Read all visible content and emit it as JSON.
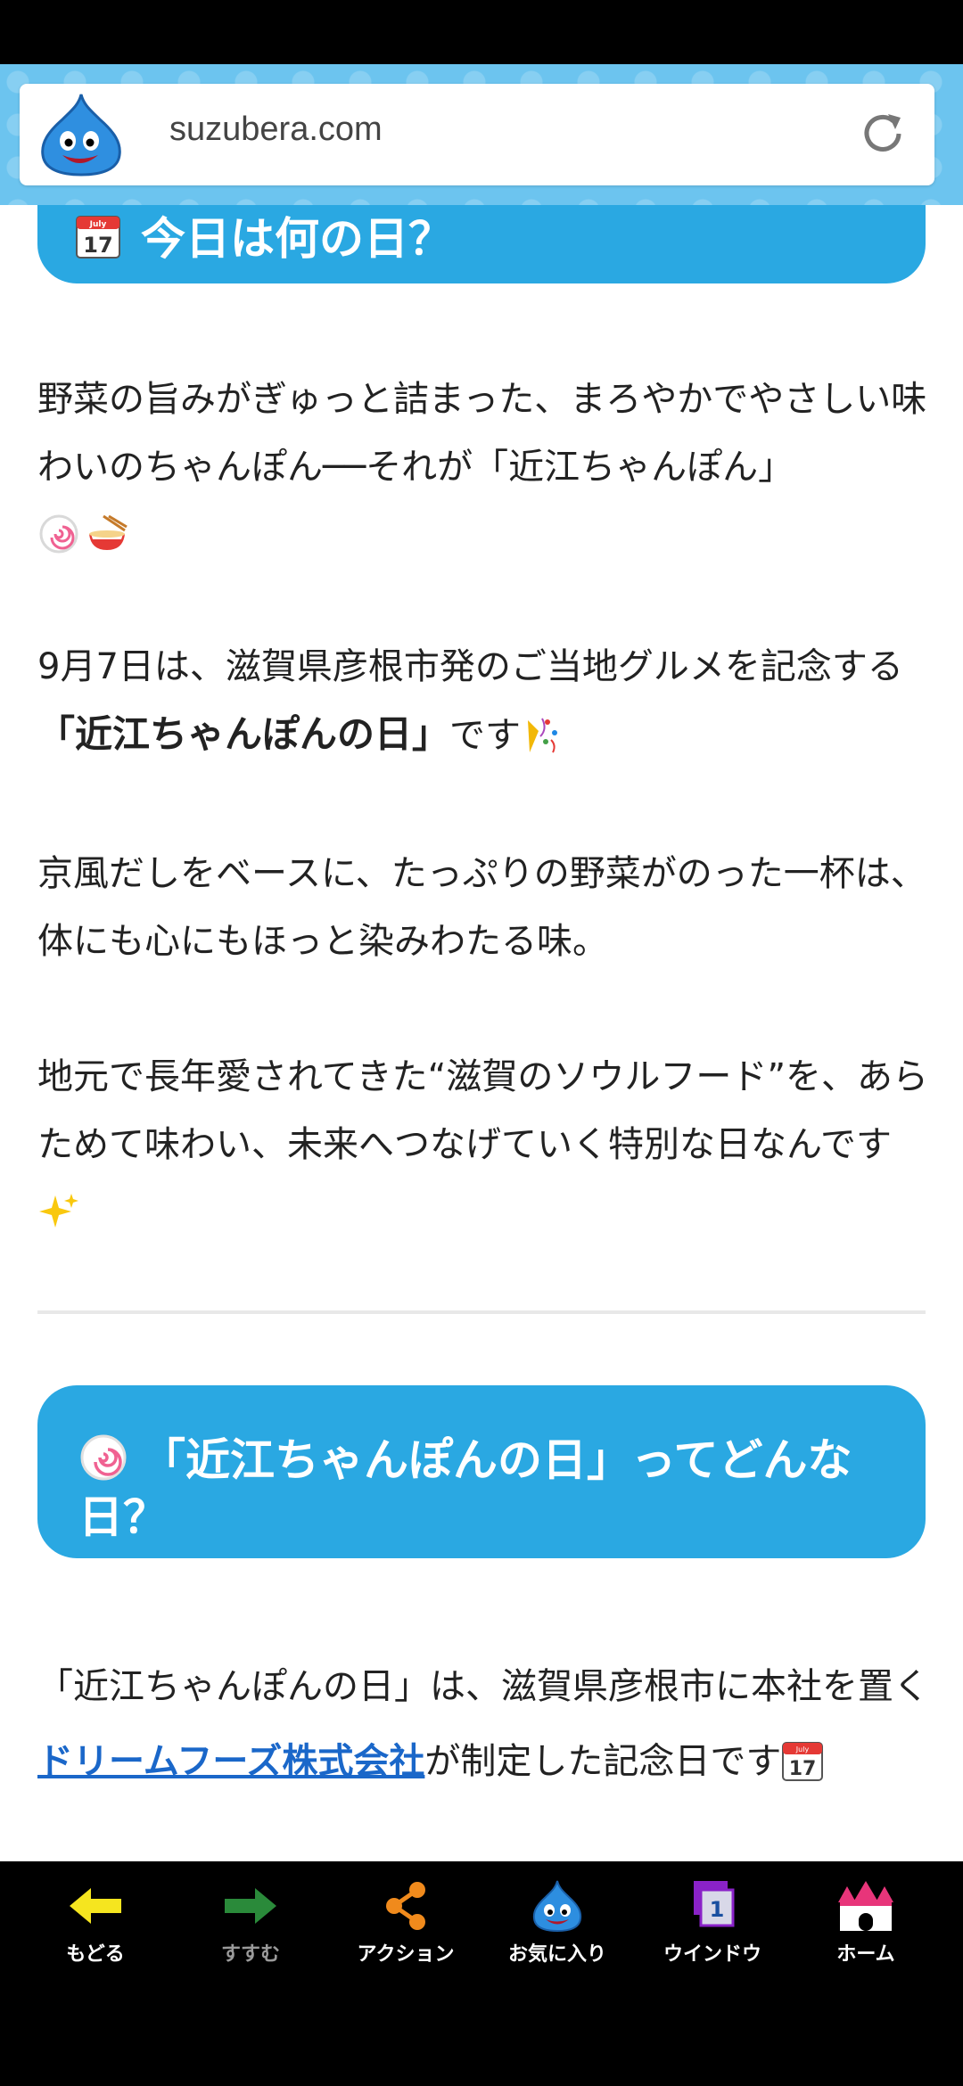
{
  "browser": {
    "url": "suzubera.com",
    "logo_icon": "slime-icon",
    "reload_icon": "reload-icon"
  },
  "article": {
    "heading1": {
      "icon": "calendar-icon",
      "text": "今日は何の日？"
    },
    "para1": {
      "text": "野菜の旨みがぎゅっと詰まった、まろやかでやさしい味わいのちゃんぽん──それが「近江ちゃんぽん」",
      "emojis": [
        "naruto-emoji",
        "ramen-emoji"
      ]
    },
    "para2": {
      "before": "9月7日は、滋賀県彦根市発のご当地グルメを記念する",
      "strong": "「近江ちゃんぽんの日」",
      "after": "です",
      "emoji": "confetti-emoji"
    },
    "para3": {
      "text": "京風だしをベースに、たっぷりの野菜がのった一杯は、体にも心にもほっと染みわたる味。"
    },
    "para4": {
      "text": "地元で長年愛されてきた“滋賀のソウルフード”を、あらためて味わい、未来へつなげていく特別な日なんです",
      "emoji": "sparkles-emoji"
    },
    "heading2": {
      "icon": "naruto-icon",
      "text": "「近江ちゃんぽんの日」ってどんな日？"
    },
    "para5": {
      "before": "「近江ちゃんぽんの日」は、滋賀県彦根市に本社を置く",
      "link": "ドリームフーズ株式会社",
      "after": "が制定した記念日です",
      "emoji": "calendar-emoji"
    }
  },
  "nav": {
    "items": [
      {
        "label": "もどる",
        "icon": "back-arrow-icon",
        "color": "#f5e51f"
      },
      {
        "label": "すすむ",
        "icon": "forward-arrow-icon",
        "color": "#2a8a3a"
      },
      {
        "label": "アクション",
        "icon": "share-icon",
        "color": "#f08a1c"
      },
      {
        "label": "お気に入り",
        "icon": "slime-favorite-icon",
        "color": "#2d8ee0"
      },
      {
        "label": "ウインドウ",
        "icon": "window-icon",
        "count": "1",
        "color": "#8a22c8"
      },
      {
        "label": "ホーム",
        "icon": "castle-home-icon",
        "color": "#e8357a"
      }
    ]
  }
}
